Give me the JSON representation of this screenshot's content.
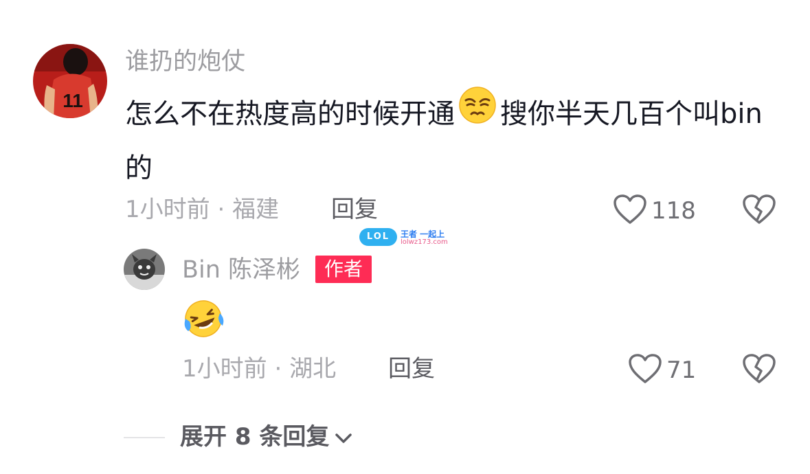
{
  "comment": {
    "username": "谁扔的炮仗",
    "text_part1": "怎么不在热度高的时候开通",
    "text_part2": "搜你半天几百个叫bin的",
    "inline_emoji": "smirk-face-emoji",
    "time": "1小时前",
    "separator": "·",
    "location": "福建",
    "reply_label": "回复",
    "likes": "118",
    "avatar_jersey_number": "11"
  },
  "reply": {
    "username": "Bin 陈泽彬",
    "badge": "作者",
    "emoji": "laughing-crying-emoji",
    "time": "1小时前",
    "separator": "·",
    "location": "湖北",
    "reply_label": "回复",
    "likes": "71"
  },
  "watermark": {
    "badge": "LOL",
    "top_text": "王者 一起上",
    "bottom_text": "lolwz173.com"
  },
  "expand": {
    "label": "展开 8 条回复"
  },
  "colors": {
    "author_badge": "#fe2c55",
    "text_primary": "#161823",
    "text_secondary": "#9c9ca0"
  }
}
